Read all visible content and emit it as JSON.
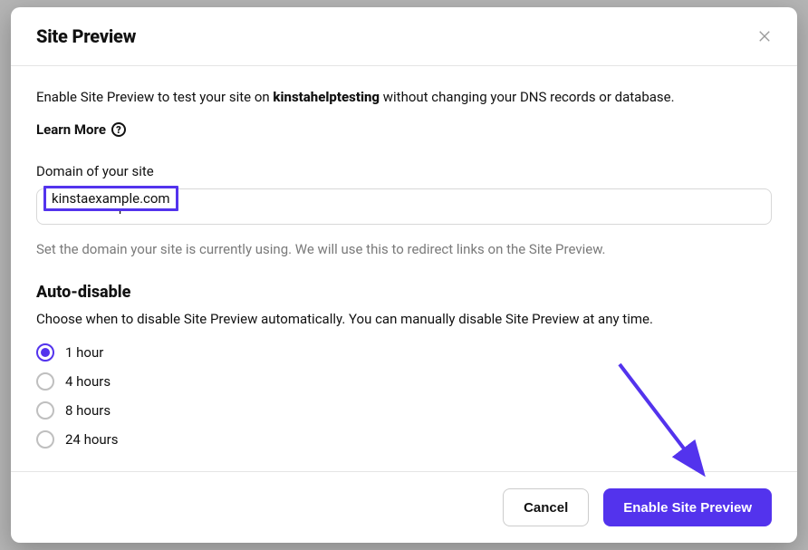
{
  "modal": {
    "title": "Site Preview",
    "intro_prefix": "Enable Site Preview to test your site on ",
    "intro_bold": "kinstahelptesting",
    "intro_suffix": " without changing your DNS records or database.",
    "learn_more": "Learn More",
    "help_glyph": "?",
    "domain": {
      "label": "Domain of your site",
      "value": "kinstaexample.com",
      "help": "Set the domain your site is currently using. We will use this to redirect links on the Site Preview."
    },
    "auto_disable": {
      "heading": "Auto-disable",
      "sub": "Choose when to disable Site Preview automatically. You can manually disable Site Preview at any time.",
      "options": [
        {
          "label": "1 hour",
          "selected": true
        },
        {
          "label": "4 hours",
          "selected": false
        },
        {
          "label": "8 hours",
          "selected": false
        },
        {
          "label": "24 hours",
          "selected": false
        }
      ]
    },
    "footer": {
      "cancel": "Cancel",
      "submit": "Enable Site Preview"
    }
  },
  "colors": {
    "accent": "#5333ed"
  }
}
